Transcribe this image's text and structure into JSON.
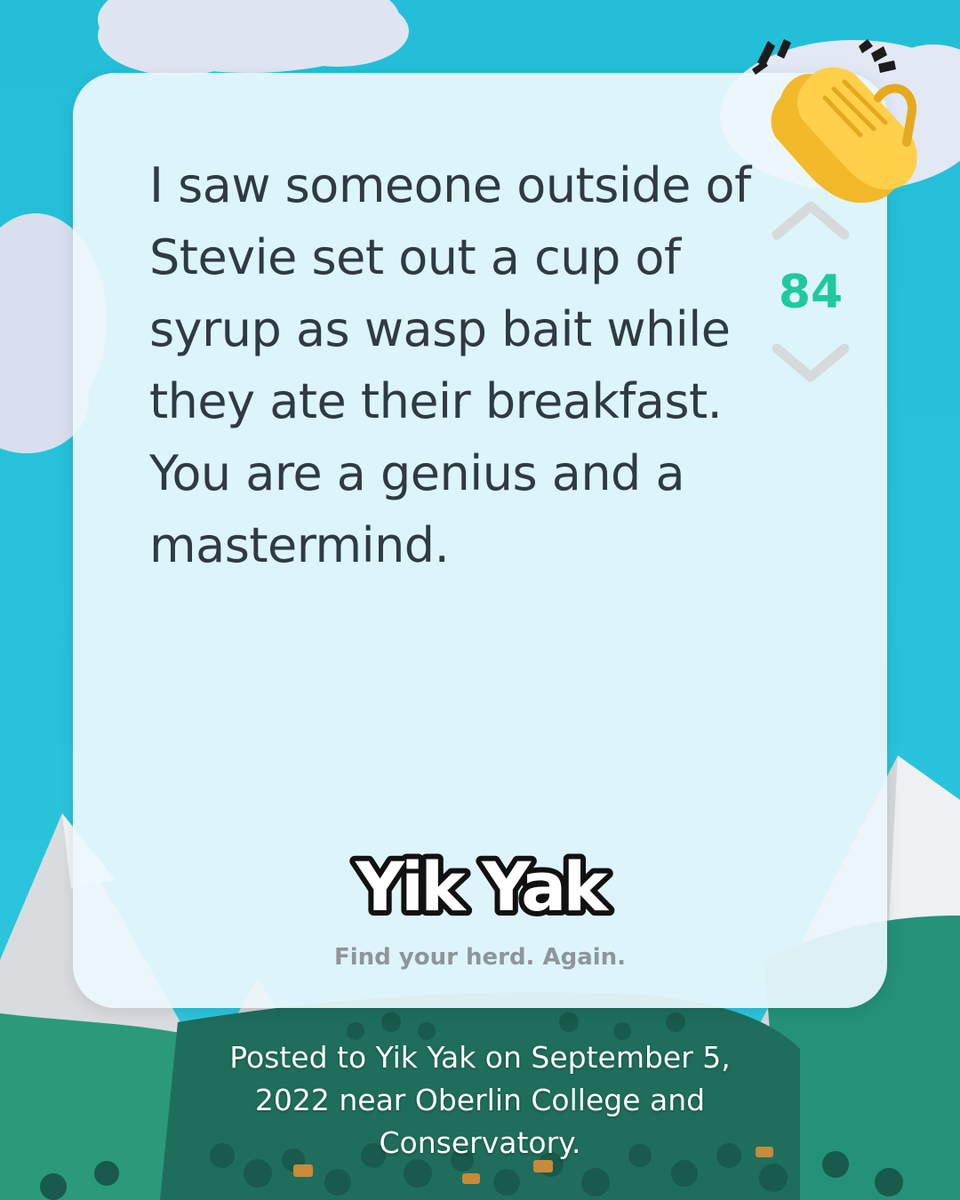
{
  "post": {
    "text": "I saw someone outside of Stevie set out a cup of syrup as wasp bait while they ate their breakfast. You are a genius and a mastermind.",
    "vote_count": "84"
  },
  "brand": {
    "logo_text": "Yik Yak",
    "tagline": "Find your herd. Again."
  },
  "caption": "Posted to Yik Yak on September 5, 2022 near Oberlin College and Conservatory.",
  "icons": {
    "upvote": "chevron-up-icon",
    "downvote": "chevron-down-icon",
    "reaction": "clapping-hands-emoji"
  },
  "colors": {
    "sky": "#23bfd8",
    "card": "#ecf8fd",
    "text": "#2f3a43",
    "vote_count": "#1ec9a0",
    "tagline": "#8e959b",
    "forest": "#1f6e5c",
    "mountain_green": "#2a9a7a"
  }
}
